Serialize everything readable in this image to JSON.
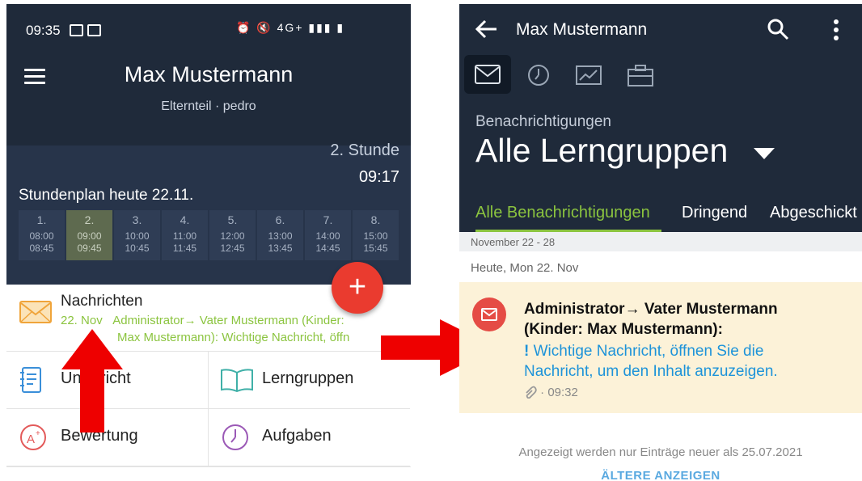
{
  "left_phone": {
    "status_bar": {
      "time": "09:35",
      "right_icons": "⏰ 🔇 4G+ ▮▮▮ ▮"
    },
    "header": {
      "user_name": "Max Mustermann",
      "role": "Elternteil · pedro",
      "menu_icon": "hamburger-icon"
    },
    "current": {
      "hour_label": "2. Stunde",
      "time": "09:17"
    },
    "schedule": {
      "title": "Stundenplan heute 22.11.",
      "slots": [
        {
          "num": "1.",
          "start": "08:00",
          "end": "08:45",
          "active": false
        },
        {
          "num": "2.",
          "start": "09:00",
          "end": "09:45",
          "active": true
        },
        {
          "num": "3.",
          "start": "10:00",
          "end": "10:45",
          "active": false
        },
        {
          "num": "4.",
          "start": "11:00",
          "end": "11:45",
          "active": false
        },
        {
          "num": "5.",
          "start": "12:00",
          "end": "12:45",
          "active": false
        },
        {
          "num": "6.",
          "start": "13:00",
          "end": "13:45",
          "active": false
        },
        {
          "num": "7.",
          "start": "14:00",
          "end": "14:45",
          "active": false
        },
        {
          "num": "8.",
          "start": "15:00",
          "end": "15:45",
          "active": false
        }
      ]
    },
    "fab_label": "+",
    "messages": {
      "title": "Nachrichten",
      "date": "22. Nov",
      "preview_line1": "Administrator→ Vater Mustermann (Kinder:",
      "preview_line2": "Max Mustermann): Wichtige Nachricht, öffn"
    },
    "tiles": [
      {
        "label": "Unterricht",
        "icon": "notebook-icon"
      },
      {
        "label": "Lerngruppen",
        "icon": "open-book-icon"
      },
      {
        "label": "Bewertung",
        "icon": "grade-a-plus-icon"
      },
      {
        "label": "Aufgaben",
        "icon": "clock-icon"
      }
    ],
    "colors": {
      "header": "#1f2a3a",
      "accent_green": "#8bc43f",
      "fab": "#ea3b2f"
    }
  },
  "right_phone": {
    "toolbar": {
      "title": "Max Mustermann",
      "back_icon": "arrow-left-icon",
      "search_icon": "search-icon",
      "more_icon": "more-vert-icon"
    },
    "section_icons": [
      "envelope-icon",
      "clock-icon",
      "chart-icon",
      "briefcase-icon"
    ],
    "subtitle": "Benachrichtigungen",
    "group": "Alle Lerngruppen",
    "tabs": [
      "Alle Benachrichtigungen",
      "Dringend",
      "Abgeschickt"
    ],
    "week": "November 22 - 28",
    "day": "Heute, Mon 22. Nov",
    "message": {
      "sender_line1": "Administrator→ Vater Mustermann",
      "sender_line2": "(Kinder: Max Mustermann):",
      "urgent_mark": "!",
      "text_line1": "Wichtige Nachricht, öffnen Sie die",
      "text_line2": "Nachricht, um den Inhalt anzuzeigen.",
      "meta": "· 09:32"
    },
    "footer_note": "Angezeigt werden nur Einträge neuer als 25.07.2021",
    "show_older": "ÄLTERE ANZEIGEN",
    "colors": {
      "card": "#fcf2d8",
      "link": "#1d93d9",
      "avatar": "#e54c45"
    }
  },
  "annotation_arrows": {
    "color": "#ee0000"
  }
}
